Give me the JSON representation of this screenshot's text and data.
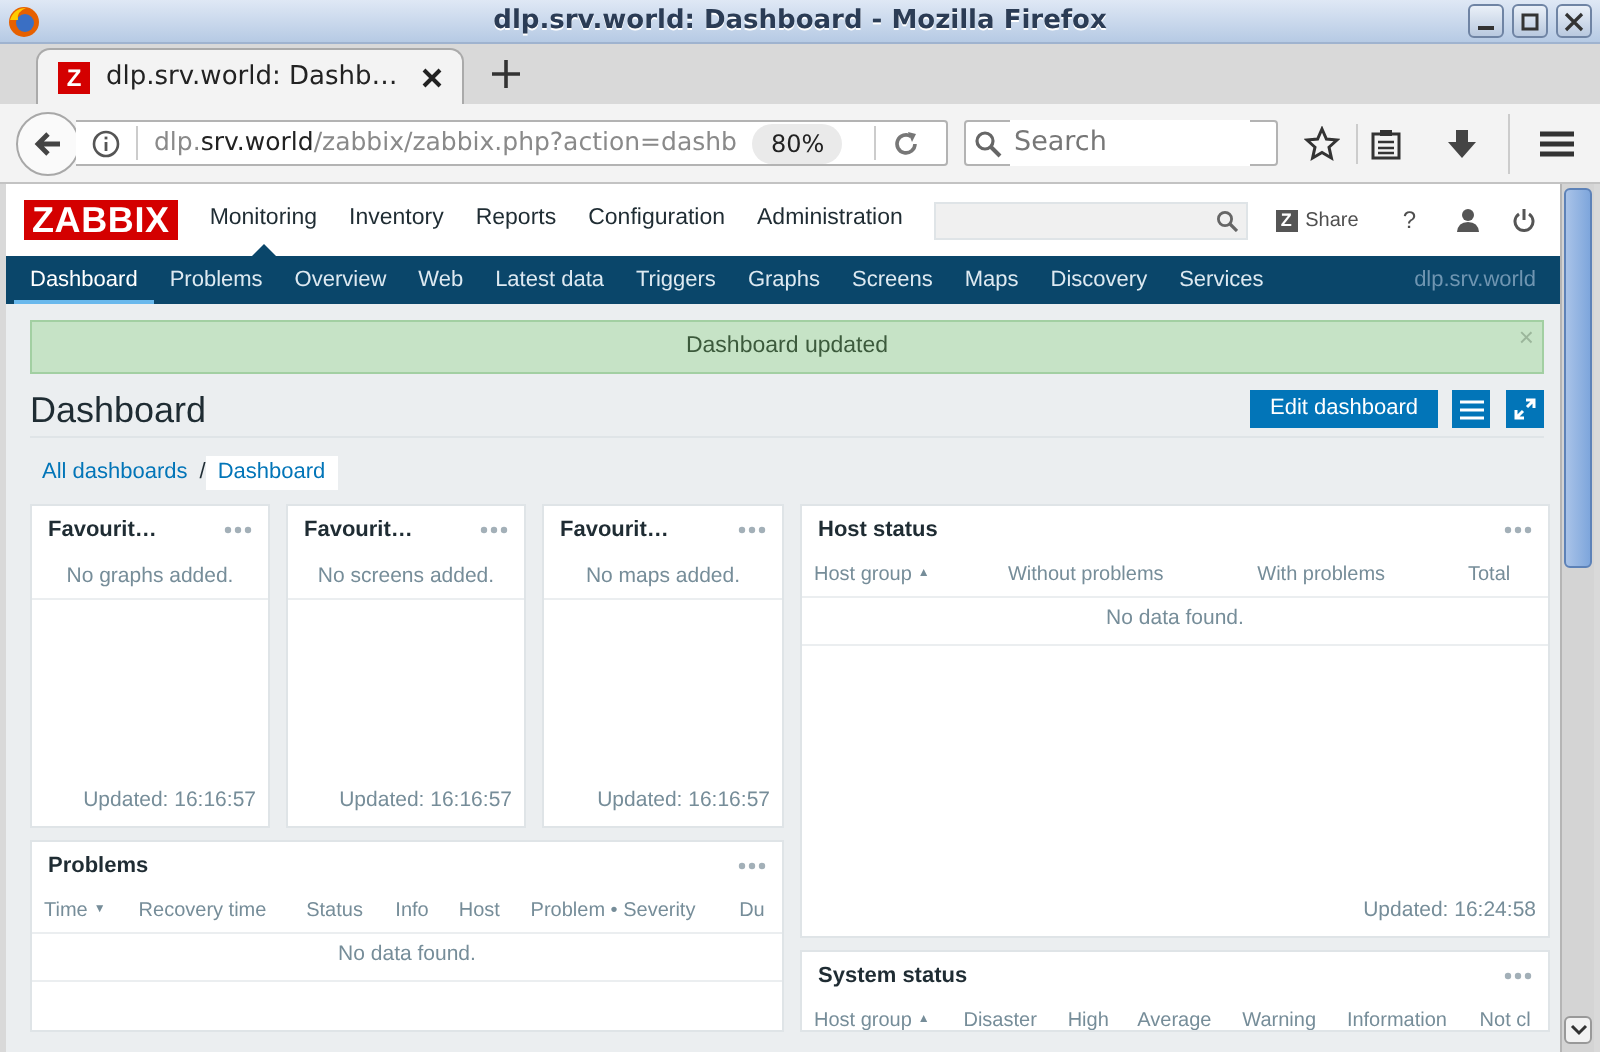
{
  "window": {
    "title": "dlp.srv.world: Dashboard - Mozilla Firefox"
  },
  "tabs": [
    {
      "favicon": "Z",
      "title": "dlp.srv.world: Dashb…",
      "selected": true
    }
  ],
  "address_bar": {
    "url_parts": [
      {
        "text": "dlp.",
        "kind": "dim"
      },
      {
        "text": "srv.world",
        "kind": "host"
      },
      {
        "text": "/zabbix/zabbix.php?action=dashb",
        "kind": "dim"
      }
    ],
    "zoom": "80%"
  },
  "search": {
    "placeholder": "Search"
  },
  "zabbix": {
    "logo": "ZABBIX",
    "menu": [
      {
        "label": "Monitoring",
        "selected": true
      },
      {
        "label": "Inventory",
        "selected": false
      },
      {
        "label": "Reports",
        "selected": false
      },
      {
        "label": "Configuration",
        "selected": false
      },
      {
        "label": "Administration",
        "selected": false
      }
    ],
    "share": {
      "icon": "Z",
      "label": "Share"
    },
    "help": "?",
    "submenu": [
      {
        "label": "Dashboard",
        "selected": true
      },
      {
        "label": "Problems",
        "selected": false
      },
      {
        "label": "Overview",
        "selected": false
      },
      {
        "label": "Web",
        "selected": false
      },
      {
        "label": "Latest data",
        "selected": false
      },
      {
        "label": "Triggers",
        "selected": false
      },
      {
        "label": "Graphs",
        "selected": false
      },
      {
        "label": "Screens",
        "selected": false
      },
      {
        "label": "Maps",
        "selected": false
      },
      {
        "label": "Discovery",
        "selected": false
      },
      {
        "label": "Services",
        "selected": false
      }
    ],
    "server": "dlp.srv.world"
  },
  "message": {
    "text": "Dashboard updated",
    "close": "×"
  },
  "dashboard": {
    "title": "Dashboard",
    "edit_button": "Edit dashboard",
    "breadcrumbs": [
      {
        "label": "All dashboards",
        "selected": false
      },
      {
        "label": "Dashboard",
        "selected": true
      }
    ],
    "breadcrumb_separator": "/"
  },
  "widgets": [
    {
      "kind": "favourites",
      "title": "Favourit…",
      "message": "No graphs added.",
      "updated": "Updated: 16:16:57"
    },
    {
      "kind": "favourites",
      "title": "Favourit…",
      "message": "No screens added.",
      "updated": "Updated: 16:16:57"
    },
    {
      "kind": "favourites",
      "title": "Favourit…",
      "message": "No maps added.",
      "updated": "Updated: 16:16:57"
    },
    {
      "kind": "table",
      "title": "Host status",
      "columns": [
        {
          "label": "Host group",
          "sort_arrow": "▲"
        },
        {
          "label": "Without problems"
        },
        {
          "label": "With problems"
        },
        {
          "label": "Total"
        }
      ],
      "empty": "No data found.",
      "updated": "Updated: 16:24:58"
    },
    {
      "kind": "table",
      "title": "Problems",
      "columns": [
        {
          "label": "Time",
          "sort_arrow": "▼"
        },
        {
          "label": "Recovery time"
        },
        {
          "label": "Status"
        },
        {
          "label": "Info"
        },
        {
          "label": "Host"
        },
        {
          "label": "Problem • Severity"
        },
        {
          "label": "Du"
        }
      ],
      "empty": "No data found."
    },
    {
      "kind": "table",
      "title": "System status",
      "columns": [
        {
          "label": "Host group",
          "sort_arrow": "▲"
        },
        {
          "label": "Disaster"
        },
        {
          "label": "High"
        },
        {
          "label": "Average"
        },
        {
          "label": "Warning"
        },
        {
          "label": "Information"
        },
        {
          "label": "Not cl"
        }
      ]
    }
  ]
}
